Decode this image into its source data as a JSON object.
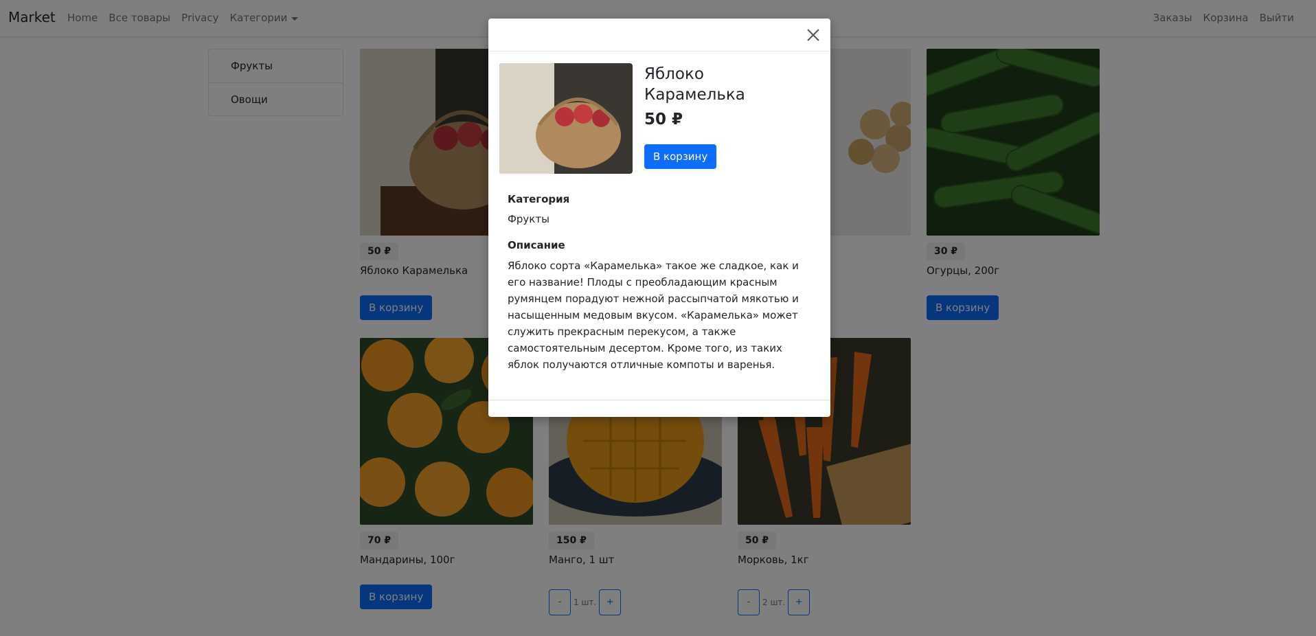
{
  "navbar": {
    "brand": "Market",
    "left_links": [
      "Home",
      "Все товары",
      "Privacy"
    ],
    "categories_dropdown": "Категории",
    "right_links": [
      "Заказы",
      "Корзина",
      "Выйти"
    ]
  },
  "sidebar": {
    "items": [
      {
        "label": "Фрукты"
      },
      {
        "label": "Овощи"
      }
    ]
  },
  "products": [
    {
      "price": "50 ₽",
      "title": "Яблоко Карамелька",
      "action": "В корзину"
    },
    {
      "price": "",
      "title": "",
      "action": ""
    },
    {
      "price": "",
      "title": "",
      "action": ""
    },
    {
      "price": "30 ₽",
      "title": "Огурцы, 200г",
      "action": "В корзину"
    },
    {
      "price": "70 ₽",
      "title": "Мандарины, 100г",
      "action": "В корзину"
    },
    {
      "price": "150 ₽",
      "title": "Манго, 1 шт",
      "stepper": {
        "minus": "-",
        "qty": "1 шт.",
        "plus": "+"
      }
    },
    {
      "price": "50 ₽",
      "title": "Морковь, 1кг",
      "stepper": {
        "minus": "-",
        "qty": "2 шт.",
        "plus": "+"
      }
    }
  ],
  "modal": {
    "title": "Яблоко Карамелька",
    "price": "50 ₽",
    "add_button": "В корзину",
    "category_label": "Категория",
    "category_value": "Фрукты",
    "description_label": "Описание",
    "description": "Яблоко сорта «Карамелька» такое же сладкое, как и его название! Плоды с преобладающим красным румянцем порадуют нежной рассыпчатой мякотью и насыщенным медовым вкусом. «Карамелька» может служить прекрасным перекусом, а также самостоятельным десертом. Кроме того, из таких яблок получаются отличные компоты и варенья."
  },
  "colors": {
    "primary": "#0d6efd",
    "backdrop": "rgba(0,0,0,0.5)"
  }
}
